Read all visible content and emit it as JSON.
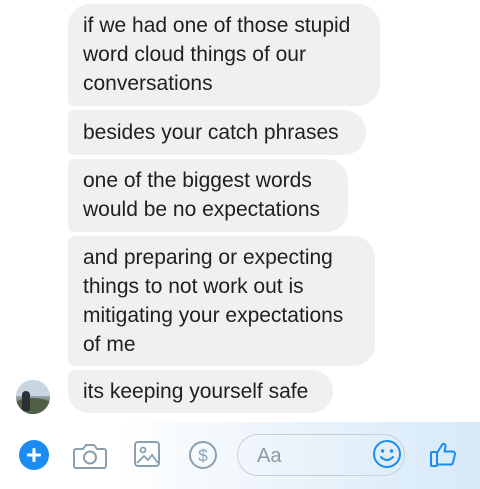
{
  "messages": [
    {
      "text": "if we had one of those stupid\nword cloud things of our\nconversations"
    },
    {
      "text": "besides your catch phrases"
    },
    {
      "text": "one of the biggest words\nwould be no expectations"
    },
    {
      "text": "and preparing or expecting\nthings to not work out is\nmitigating your expectations\nof me"
    },
    {
      "text": "its keeping yourself safe"
    }
  ],
  "composer": {
    "placeholder": "Aa",
    "icons": [
      "plus-icon",
      "camera-icon",
      "image-icon",
      "dollar-icon",
      "smile-icon",
      "thumbs-up-icon"
    ]
  },
  "colors": {
    "bubble": "#f1f0f0",
    "text": "#1f1f1f",
    "accent": "#1d8cf2",
    "icon": "#8aa0b0"
  }
}
